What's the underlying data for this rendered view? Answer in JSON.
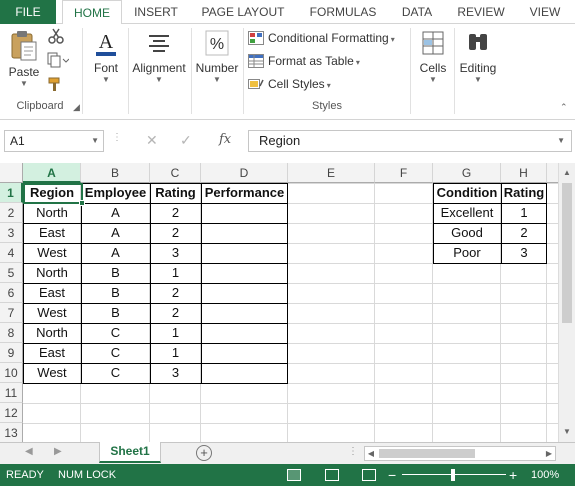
{
  "ribbon_tabs": {
    "file": "FILE",
    "home": "HOME",
    "insert": "INSERT",
    "page_layout": "PAGE LAYOUT",
    "formulas": "FORMULAS",
    "data": "DATA",
    "review": "REVIEW",
    "view": "VIEW"
  },
  "ribbon": {
    "clipboard": {
      "paste": "Paste",
      "group_label": "Clipboard"
    },
    "font": {
      "label": "Font"
    },
    "alignment": {
      "label": "Alignment"
    },
    "number": {
      "label": "Number"
    },
    "styles": {
      "conditional_formatting": "Conditional Formatting",
      "format_as_table": "Format as Table",
      "cell_styles": "Cell Styles",
      "group_label": "Styles"
    },
    "cells": {
      "label": "Cells"
    },
    "editing": {
      "label": "Editing"
    }
  },
  "formula_bar": {
    "name_box": "A1",
    "fx": "fx",
    "value": "Region"
  },
  "grid": {
    "columns": [
      "A",
      "B",
      "C",
      "D",
      "E",
      "F",
      "G",
      "H"
    ],
    "selected_column": "A",
    "rows": [
      "1",
      "2",
      "3",
      "4",
      "5",
      "6",
      "7",
      "8",
      "9",
      "10",
      "11",
      "12",
      "13"
    ],
    "selected_row": "1",
    "main_table": {
      "headers": [
        "Region",
        "Employee",
        "Rating",
        "Performance"
      ],
      "rows": [
        [
          "North",
          "A",
          "2",
          ""
        ],
        [
          "East",
          "A",
          "2",
          ""
        ],
        [
          "West",
          "A",
          "3",
          ""
        ],
        [
          "North",
          "B",
          "1",
          ""
        ],
        [
          "East",
          "B",
          "2",
          ""
        ],
        [
          "West",
          "B",
          "2",
          ""
        ],
        [
          "North",
          "C",
          "1",
          ""
        ],
        [
          "East",
          "C",
          "1",
          ""
        ],
        [
          "West",
          "C",
          "3",
          ""
        ]
      ]
    },
    "lookup_table": {
      "headers": [
        "Condition",
        "Rating"
      ],
      "rows": [
        [
          "Excellent",
          "1"
        ],
        [
          "Good",
          "2"
        ],
        [
          "Poor",
          "3"
        ]
      ]
    }
  },
  "sheets": {
    "active": "Sheet1"
  },
  "status_bar": {
    "ready": "READY",
    "num_lock": "NUM LOCK",
    "zoom": "100%"
  },
  "colors": {
    "accent": "#217346",
    "header_bg": "#f3f3f3",
    "selected_header_bg": "#d3f0e0"
  }
}
